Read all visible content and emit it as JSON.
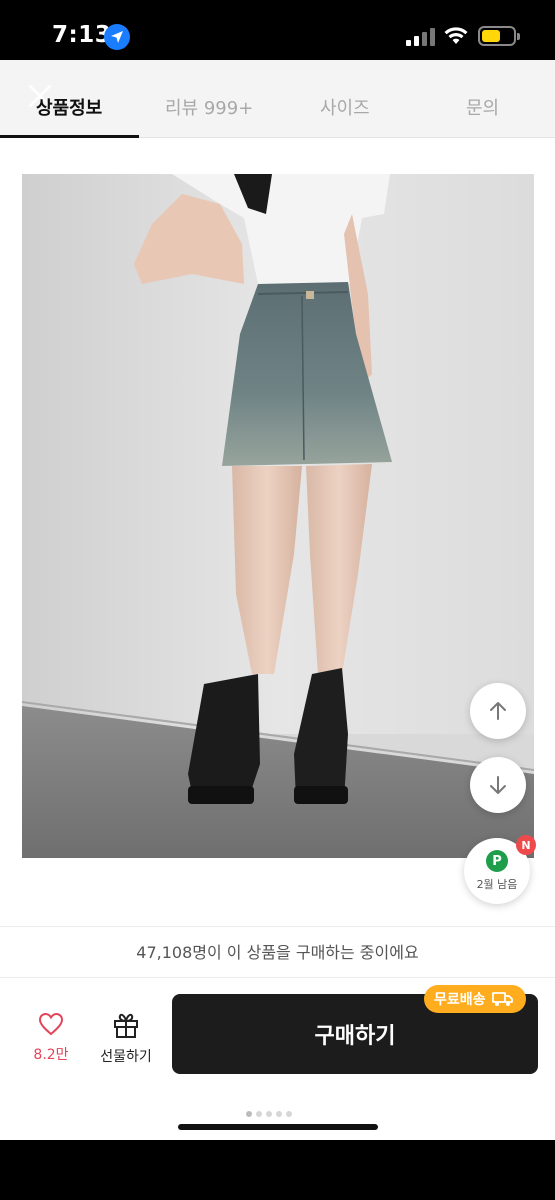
{
  "status_bar": {
    "time": "7:13"
  },
  "tabs": [
    {
      "label": "상품정보",
      "active": true
    },
    {
      "label": "리뷰 999+",
      "active": false
    },
    {
      "label": "사이즈",
      "active": false
    },
    {
      "label": "문의",
      "active": false
    }
  ],
  "points_widget": {
    "badge": "P",
    "text": "2월 남음",
    "new_badge": "N"
  },
  "buyers_notice": "47,108명이 이 상품을 구매하는 중이에요",
  "bottom_bar": {
    "like_count": "8.2만",
    "gift_label": "선물하기",
    "buy_label": "구매하기",
    "free_shipping_label": "무료배송"
  },
  "colors": {
    "buy_button": "#1c1c1c",
    "free_shipping_badge": "#ffad1f",
    "like": "#e3455a"
  },
  "icons": [
    "location-arrow-icon",
    "signal-icon",
    "wifi-icon",
    "battery-icon",
    "close-icon",
    "arrow-up-icon",
    "arrow-down-icon",
    "heart-icon",
    "gift-icon",
    "truck-icon"
  ]
}
